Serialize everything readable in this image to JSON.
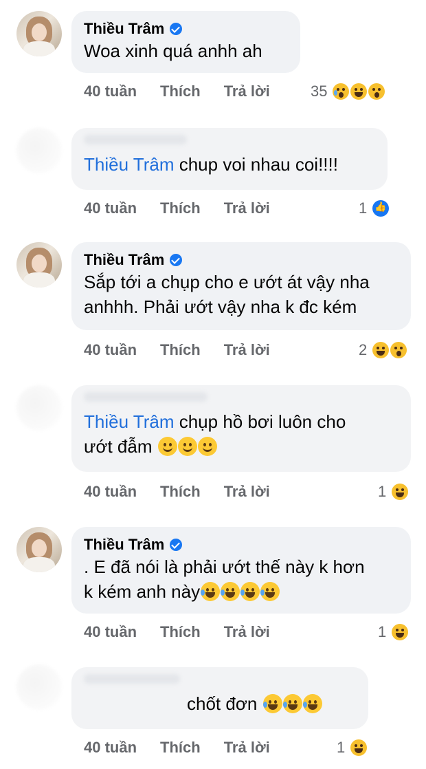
{
  "comments": [
    {
      "author": "Thiều Trâm",
      "verified": true,
      "text": "Woa xinh quá anhh ah",
      "time": "40 tuần",
      "like_label": "Thích",
      "reply_label": "Trả lời",
      "reaction_count": "35",
      "reactions": [
        "sad-icon",
        "laugh-icon",
        "wow-icon"
      ]
    },
    {
      "author": "",
      "mention": "Thiều Trâm",
      "text": " chup voi nhau coi!!!!",
      "time": "40 tuần",
      "like_label": "Thích",
      "reply_label": "Trả lời",
      "reaction_count": "1",
      "reactions": [
        "like-icon"
      ]
    },
    {
      "author": "Thiều Trâm",
      "verified": true,
      "text_line1": "Sắp tới a chụp cho e ướt át vậy nha",
      "text_line2": "anhhh. Phải ướt vậy nha k đc kém",
      "time": "40 tuần",
      "like_label": "Thích",
      "reply_label": "Trả lời",
      "reaction_count": "2",
      "reactions": [
        "laugh-icon",
        "wow-icon"
      ]
    },
    {
      "author": "",
      "mention": "Thiều Trâm",
      "text_line1": " chụp hồ bơi luôn cho",
      "text_line2": "ướt đẫm ",
      "time": "40 tuần",
      "like_label": "Thích",
      "reply_label": "Trả lời",
      "reaction_count": "1",
      "reactions": [
        "laugh-icon"
      ]
    },
    {
      "author": "Thiều Trâm",
      "verified": true,
      "text_line1": ". E đã nói là phải ướt thế này k hơn",
      "text_line2": "k kém anh này",
      "time": "40 tuần",
      "like_label": "Thích",
      "reply_label": "Trả lời",
      "reaction_count": "1",
      "reactions": [
        "laugh-icon"
      ]
    },
    {
      "author": "",
      "text": "chốt đơn ",
      "time": "40 tuần",
      "like_label": "Thích",
      "reply_label": "Trả lời",
      "reaction_count": "1",
      "reactions": [
        "laugh-icon"
      ]
    }
  ],
  "colors": {
    "bubble": "#f0f2f5",
    "mention": "#216fdb",
    "meta": "#65676b",
    "verified": "#1877f2"
  }
}
